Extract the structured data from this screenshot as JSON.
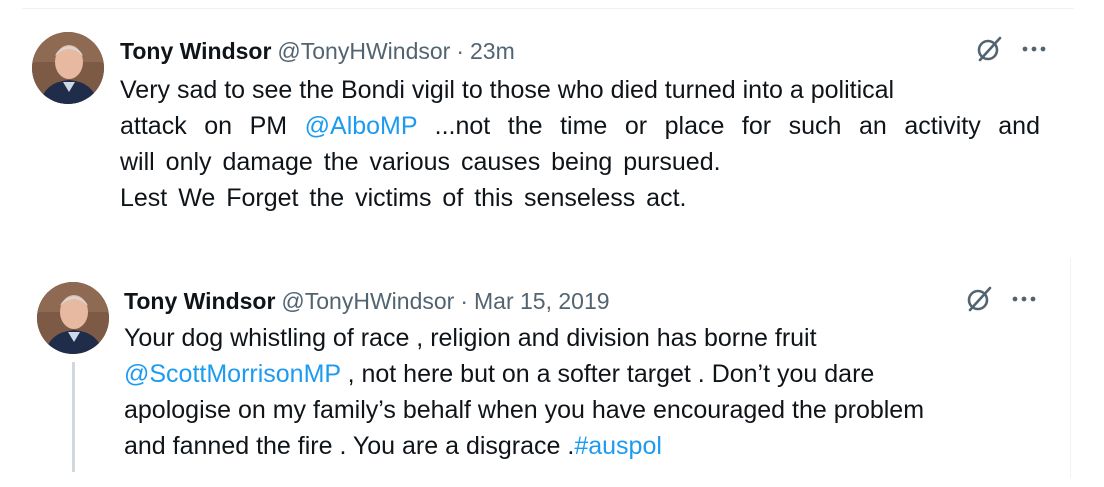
{
  "tweets": [
    {
      "author": {
        "name": "Tony Windsor",
        "handle": "@TonyHWindsor"
      },
      "separator": "·",
      "time": "23m",
      "lines": [
        {
          "text_before": "Very sad to see the Bondi vigil to those who died turned into a political"
        },
        {
          "text_before": "attack on PM ",
          "mention": "@AlboMP",
          "text_after": " ...not the time or place for such an activity and"
        },
        {
          "text_before": "will only damage the various causes being pursued."
        },
        {
          "text_before": "Lest We Forget the victims of this senseless act."
        }
      ]
    },
    {
      "author": {
        "name": "Tony Windsor",
        "handle": "@TonyHWindsor"
      },
      "separator": "·",
      "time": "Mar 15, 2019",
      "lines": [
        {
          "text_before": "Your dog whistling of race , religion and division has borne fruit"
        },
        {
          "mention": "@ScottMorrisonMP",
          "text_after": " , not here but on a softer target . Don’t you dare"
        },
        {
          "text_before": "apologise on my family’s behalf when you have encouraged the problem"
        },
        {
          "text_before": "and fanned the fire . You are a disgrace .",
          "hashtag": "#auspol"
        }
      ]
    }
  ],
  "icons": {
    "grok": "grok-slash-icon",
    "more": "more-horizontal-icon"
  },
  "colors": {
    "link": "#1d9bf0",
    "secondary": "#536471",
    "text": "#0f1419"
  }
}
